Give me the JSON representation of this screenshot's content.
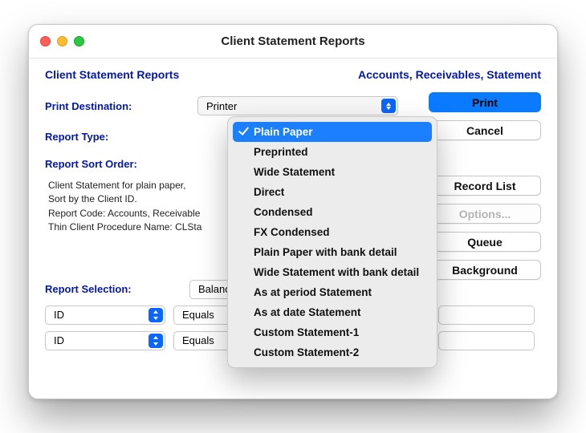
{
  "window": {
    "title": "Client Statement Reports"
  },
  "header": {
    "left": "Client Statement Reports",
    "right": "Accounts, Receivables, Statement"
  },
  "labels": {
    "print_destination": "Print Destination:",
    "report_type": "Report Type:",
    "report_sort_order": "Report Sort Order:",
    "report_selection": "Report Selection:"
  },
  "fields": {
    "print_destination": "Printer",
    "selection_main": "Balance",
    "filter1_field": "ID",
    "filter1_op": "Equals",
    "filter2_field": "ID",
    "filter2_op": "Equals"
  },
  "description": {
    "l1": "Client Statement for plain paper,",
    "l2": "Sort by the Client ID.",
    "l3": "Report Code: Accounts, Receivable",
    "l4": "Thin Client Procedure Name: CLSta"
  },
  "buttons": {
    "print": "Print",
    "cancel": "Cancel",
    "record_list": "Record List",
    "options": "Options...",
    "queue": "Queue",
    "background": "Background"
  },
  "menu": {
    "selected": "Plain Paper",
    "items": [
      "Plain Paper",
      "Preprinted",
      "Wide Statement",
      "Direct",
      "Condensed",
      "FX Condensed",
      "Plain Paper with bank detail",
      "Wide Statement with bank detail",
      "As at period Statement",
      "As at date Statement",
      "Custom Statement-1",
      "Custom Statement-2"
    ]
  }
}
